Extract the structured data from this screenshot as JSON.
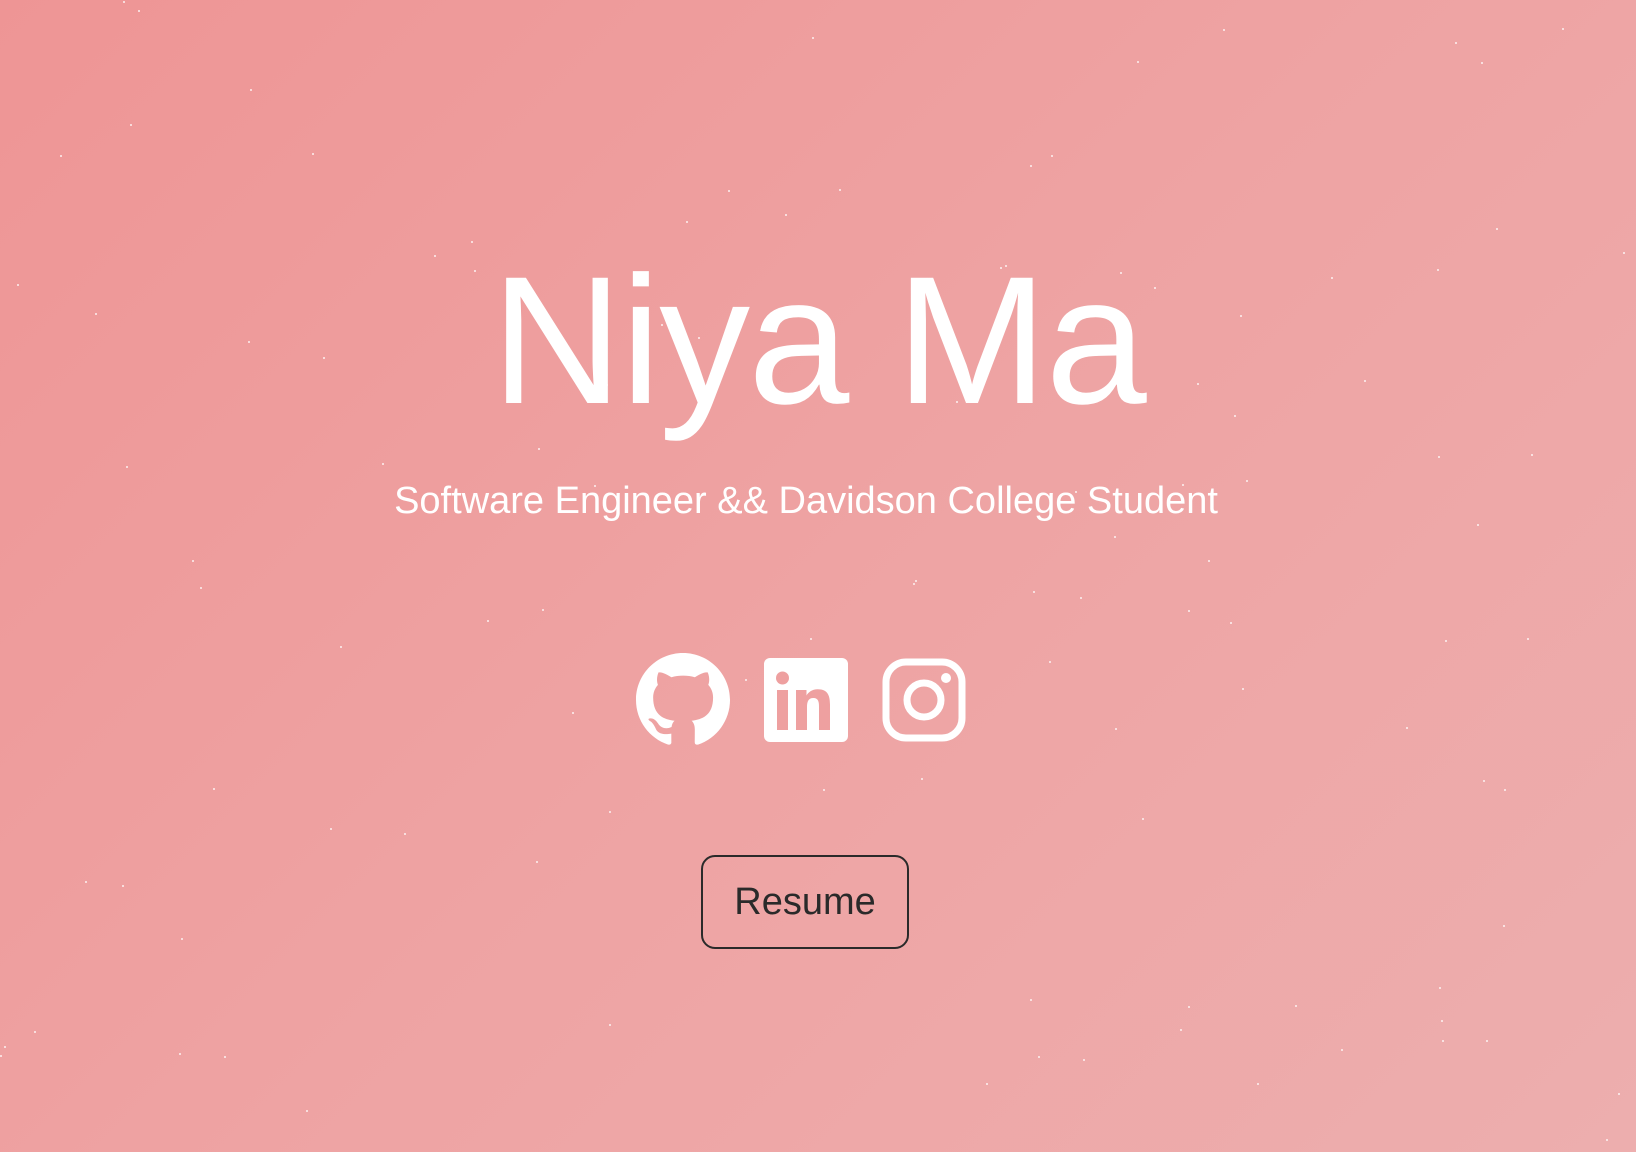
{
  "hero": {
    "name": "Niya Ma",
    "subtitle": "Software Engineer && Davidson College Student"
  },
  "socials": [
    {
      "icon": "github-icon"
    },
    {
      "icon": "linkedin-icon"
    },
    {
      "icon": "instagram-icon"
    }
  ],
  "resume_button": {
    "label": "Resume"
  },
  "colors": {
    "background_start": "#ee9595",
    "background_end": "#edaeae",
    "text": "#ffffff",
    "button_border": "#2a2a2a"
  }
}
